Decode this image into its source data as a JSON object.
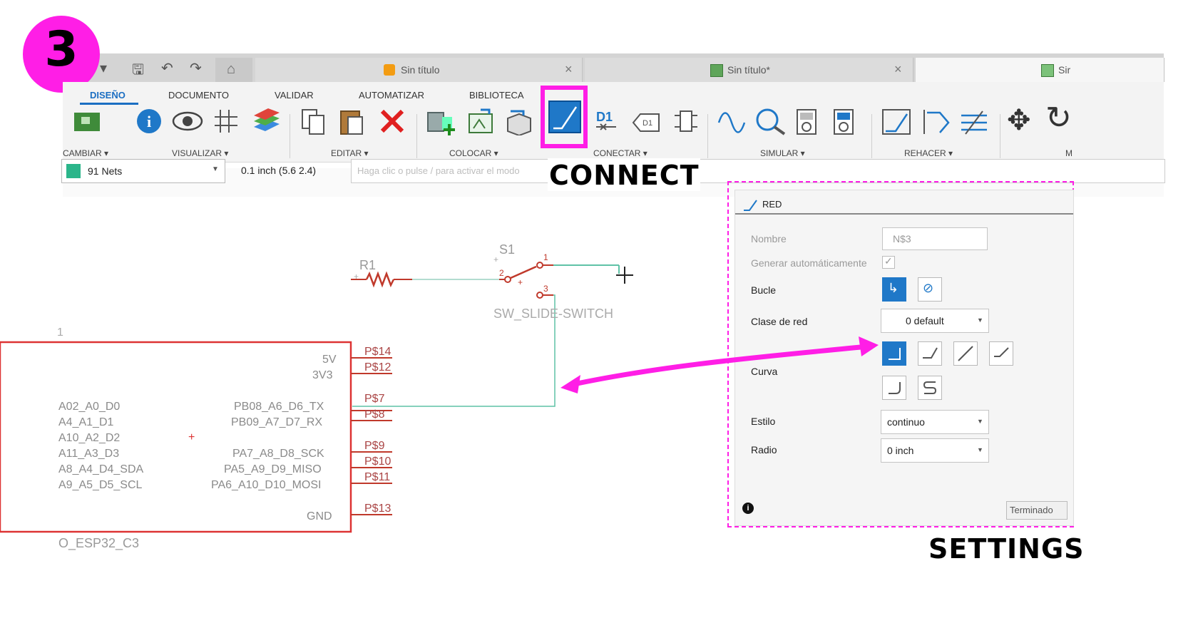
{
  "step_badge": "3",
  "tabs": [
    {
      "title": "Sin título",
      "close": "×"
    },
    {
      "title": "Sin título*",
      "close": "×"
    },
    {
      "title": "Sir"
    }
  ],
  "ribbon_tabs": [
    "DISEÑO",
    "DOCUMENTO",
    "VALIDAR",
    "AUTOMATIZAR",
    "BIBLIOTECA"
  ],
  "ribbon_groups": [
    "CAMBIAR ▾",
    "VISUALIZAR ▾",
    "EDITAR ▾",
    "COLOCAR ▾",
    "CONECTAR ▾",
    "SIMULAR ▾",
    "REHACER ▾",
    "M"
  ],
  "command_bar": {
    "net_select": "91 Nets",
    "coords": "0.1 inch (5.6 2.4)",
    "command_placeholder": "Haga clic o pulse / para activar el modo"
  },
  "callouts": {
    "connect": "CONNECT",
    "settings": "SETTINGS"
  },
  "schematic": {
    "r1": "R1",
    "s1": "S1",
    "s1_pin1": "1",
    "s1_pin2": "2",
    "s1_pin3": "3",
    "switch_value": "SW_SLIDE-SWITCH",
    "chip_name": "O_ESP32_C3",
    "chip_left_fragment": "1",
    "left_pins": [
      "A02_A0_D0",
      "A4_A1_D1",
      "A10_A2_D2",
      "A11_A3_D3",
      "A8_A4_D4_SDA",
      "A9_A5_D5_SCL"
    ],
    "right_pins": [
      "5V",
      "3V3",
      "PB08_A6_D6_TX",
      "PB09_A7_D7_RX",
      "PA7_A8_D8_SCK",
      "PA5_A9_D9_MISO",
      "PA6_A10_D10_MOSI",
      "GND"
    ],
    "pin_numbers": [
      "P$14",
      "P$12",
      "P$7",
      "P$8",
      "P$9",
      "P$10",
      "P$11",
      "P$13"
    ]
  },
  "panel": {
    "title": "RED",
    "nombre_label": "Nombre",
    "nombre_value": "N$3",
    "auto_label": "Generar automáticamente",
    "bucle_label": "Bucle",
    "clase_label": "Clase de red",
    "clase_value": "0 default",
    "curva_label": "Curva",
    "estilo_label": "Estilo",
    "estilo_value": "continuo",
    "radio_label": "Radio",
    "radio_value": "0 inch",
    "done_button": "Terminado"
  },
  "colors": {
    "accent_magenta": "#ff1ee6",
    "wire_green": "#5fc2a6",
    "part_red": "#c0392b",
    "select_blue": "#1f78c8"
  }
}
